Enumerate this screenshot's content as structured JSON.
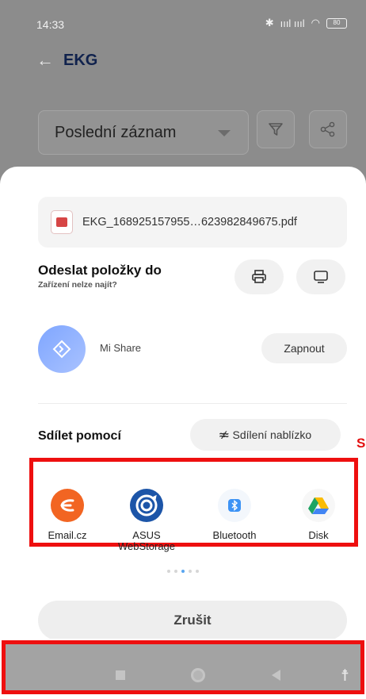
{
  "status_bar": {
    "time": "14:33",
    "signal": "ıııl ıııl",
    "battery": "80"
  },
  "app": {
    "title": "EKG",
    "back_icon": "arrow-left-icon"
  },
  "filter": {
    "selected": "Poslední záznam",
    "filter_icon": "funnel-icon",
    "share_icon": "share-icon"
  },
  "sheet": {
    "file_name": "EKG_168925157955…623982849675.pdf",
    "send_title": "Odeslat položky do",
    "send_subtitle": "Zařízení nelze najít?",
    "device_buttons": [
      {
        "icon": "printer-icon"
      },
      {
        "icon": "monitor-icon"
      }
    ],
    "mi_share": {
      "label": "Mi Share",
      "enable_label": "Zapnout"
    },
    "share_via": "Sdílet pomocí",
    "nearby_label": "Sdílení nablízko",
    "annotation_char": "S",
    "apps": [
      {
        "label": "Email.cz",
        "icon": "email-cz-icon",
        "color": "#f26522"
      },
      {
        "label": "ASUS WebStorage",
        "icon": "asus-webstorage-icon",
        "color": "#1c55a8"
      },
      {
        "label": "Bluetooth",
        "icon": "bluetooth-icon",
        "color": "#3d93f5"
      },
      {
        "label": "Disk",
        "icon": "google-drive-icon",
        "color": "#1fa463"
      }
    ],
    "pager": {
      "pages": 5,
      "active": 3
    },
    "cancel_label": "Zrušit"
  },
  "nav": {
    "recent_icon": "square-icon",
    "home_icon": "circle-icon",
    "back_icon": "triangle-back-icon",
    "accessibility_icon": "accessibility-icon"
  },
  "colors": {
    "highlight": "#ee0f0f",
    "title": "#10224d",
    "accent": "#5aa6f0"
  }
}
